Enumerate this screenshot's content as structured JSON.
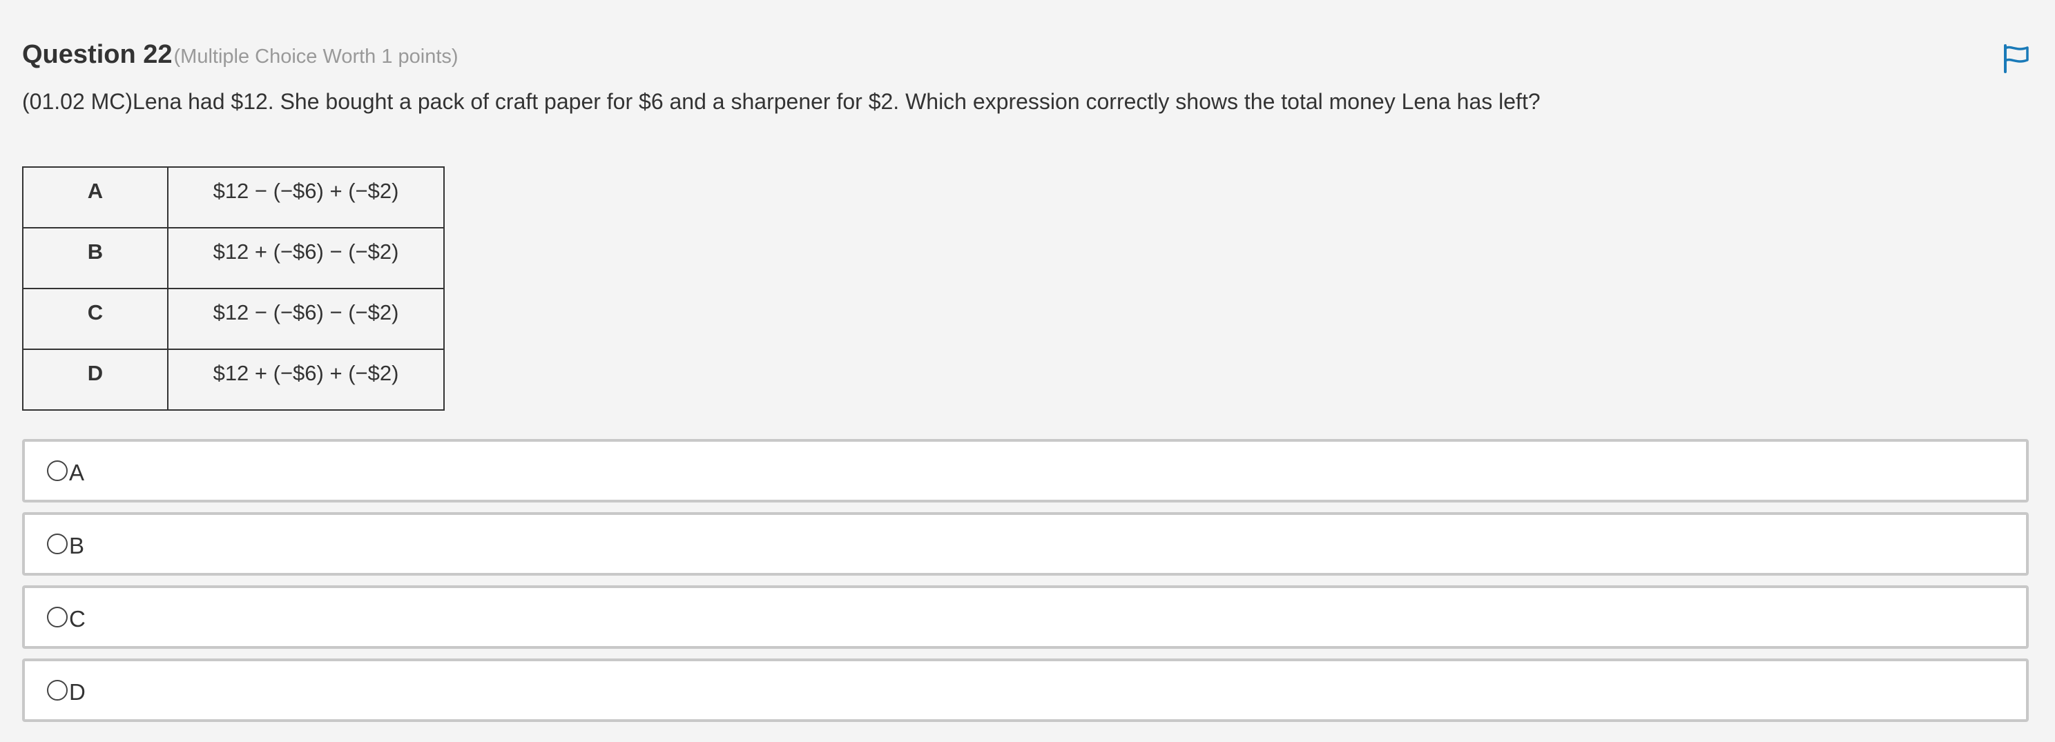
{
  "question": {
    "title": "Question 22",
    "meta": "(Multiple Choice Worth 1 points)",
    "prompt": "(01.02 MC)Lena had $12. She bought a pack of craft paper for $6 and a sharpener for $2. Which expression correctly shows the total money Lena has left?",
    "flag_icon": "flag-icon",
    "accent_color": "#1a7ab8"
  },
  "choices_table": [
    {
      "letter": "A",
      "expression": "$12 − (−$6) + (−$2)"
    },
    {
      "letter": "B",
      "expression": "$12 + (−$6) − (−$2)"
    },
    {
      "letter": "C",
      "expression": "$12 − (−$6) − (−$2)"
    },
    {
      "letter": "D",
      "expression": "$12 + (−$6) + (−$2)"
    }
  ],
  "options": [
    {
      "label": "A"
    },
    {
      "label": "B"
    },
    {
      "label": "C"
    },
    {
      "label": "D"
    }
  ]
}
